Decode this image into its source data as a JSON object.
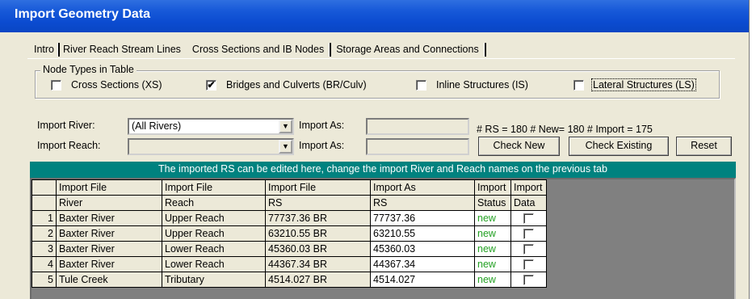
{
  "window": {
    "title": "Import Geometry Data"
  },
  "tabs": [
    {
      "label": "Intro"
    },
    {
      "label": "River Reach Stream Lines"
    },
    {
      "label": "Cross Sections and IB Nodes"
    },
    {
      "label": "Storage Areas and Connections"
    }
  ],
  "node_types": {
    "legend": "Node Types in Table",
    "options": [
      {
        "label": "Cross Sections (XS)",
        "checked": false,
        "mark": ""
      },
      {
        "label": "Bridges and Culverts (BR/Culv)",
        "checked": true,
        "mark": "✔"
      },
      {
        "label": "Inline Structures (IS)",
        "checked": false,
        "mark": ""
      },
      {
        "label": "Lateral Structures (LS)",
        "checked": false,
        "mark": ""
      }
    ]
  },
  "import": {
    "river_label": "Import River:",
    "river_value": "(All Rivers)",
    "reach_label": "Import Reach:",
    "reach_value": "",
    "import_as_label": "Import As:",
    "import_as_river": "",
    "import_as_reach": "",
    "dropdown_arrow": "▼"
  },
  "summary": "# RS = 180  # New= 180  # Import = 175",
  "buttons": {
    "check_new": "Check New",
    "check_existing": "Check Existing",
    "reset": "Reset"
  },
  "banner": "The imported RS can be edited here, change the import River and Reach names on the previous tab",
  "table": {
    "headers_row1": [
      "Import File",
      "Import File",
      "Import File",
      "Import As",
      "Import",
      "Import"
    ],
    "headers_row2": [
      "River",
      "Reach",
      "RS",
      "RS",
      "Status",
      "Data"
    ],
    "rows": [
      {
        "num": "1",
        "river": "Baxter River",
        "reach": "Upper Reach",
        "rs": "77737.36 BR",
        "as": "77737.36",
        "status": "new"
      },
      {
        "num": "2",
        "river": "Baxter River",
        "reach": "Upper Reach",
        "rs": "63210.55 BR",
        "as": "63210.55",
        "status": "new"
      },
      {
        "num": "3",
        "river": "Baxter River",
        "reach": "Lower Reach",
        "rs": "45360.03 BR",
        "as": "45360.03",
        "status": "new"
      },
      {
        "num": "4",
        "river": "Baxter River",
        "reach": "Lower Reach",
        "rs": "44367.34 BR",
        "as": "44367.34",
        "status": "new"
      },
      {
        "num": "5",
        "river": "Tule Creek",
        "reach": "Tributary",
        "rs": "4514.027 BR",
        "as": "4514.027",
        "status": "new"
      }
    ]
  },
  "colors": {
    "title_bar": "#0b4bd0",
    "banner": "#00827f",
    "status_new": "#22a022"
  }
}
